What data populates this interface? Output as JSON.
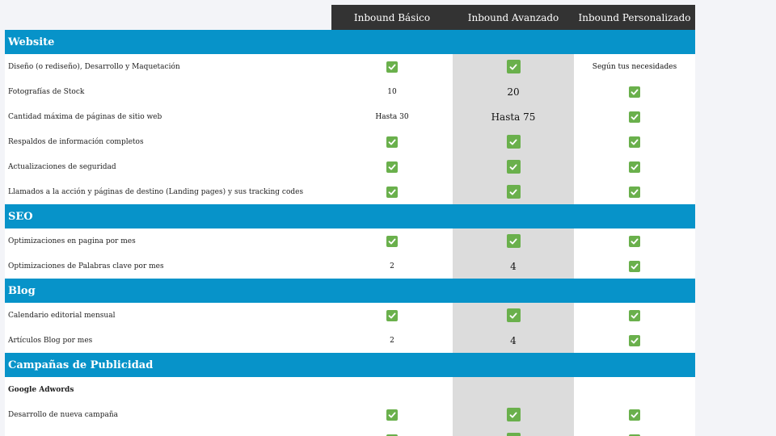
{
  "plans": [
    {
      "name": "Inbound Básico"
    },
    {
      "name": "Inbound Avanzado"
    },
    {
      "name": "Inbound Personalizado"
    }
  ],
  "colors": {
    "section_bg": "#0793c9",
    "header_bg": "#333333",
    "check_green": "#6ab04c",
    "highlight_col": "#dcdcdc"
  },
  "sections": [
    {
      "title": "Website",
      "rows": [
        {
          "label": "Diseño (o rediseño), Desarrollo y Maquetación",
          "values": [
            "check",
            "check",
            "Según tus necesidades"
          ]
        },
        {
          "label": "Fotografías de Stock",
          "values": [
            "10",
            "20",
            "check"
          ]
        },
        {
          "label": "Cantidad máxima de páginas de sitio web",
          "values": [
            "Hasta 30",
            "Hasta 75",
            "check"
          ]
        },
        {
          "label": "Respaldos de información completos",
          "values": [
            "check",
            "check",
            "check"
          ]
        },
        {
          "label": "Actualizaciones de seguridad",
          "values": [
            "check",
            "check",
            "check"
          ]
        },
        {
          "label": "Llamados a la acción y páginas de destino (Landing pages) y sus tracking codes",
          "values": [
            "check",
            "check",
            "check"
          ]
        }
      ]
    },
    {
      "title": "SEO",
      "rows": [
        {
          "label": "Optimizaciones en pagina por mes",
          "values": [
            "check",
            "check",
            "check"
          ]
        },
        {
          "label": "Optimizaciones de Palabras clave por mes",
          "values": [
            "2",
            "4",
            "check"
          ]
        }
      ]
    },
    {
      "title": "Blog",
      "rows": [
        {
          "label": "Calendario editorial mensual",
          "values": [
            "check",
            "check",
            "check"
          ]
        },
        {
          "label": "Artículos Blog por mes",
          "values": [
            "2",
            "4",
            "check"
          ]
        }
      ]
    },
    {
      "title": "Campañas de Publicidad",
      "rows": [
        {
          "label": "Google Adwords",
          "bold": true,
          "values": [
            "",
            "",
            ""
          ]
        },
        {
          "label": "Desarrollo de nueva campaña",
          "values": [
            "check",
            "check",
            "check"
          ]
        },
        {
          "label": "",
          "values": [
            "check",
            "check",
            "check"
          ]
        }
      ]
    }
  ]
}
